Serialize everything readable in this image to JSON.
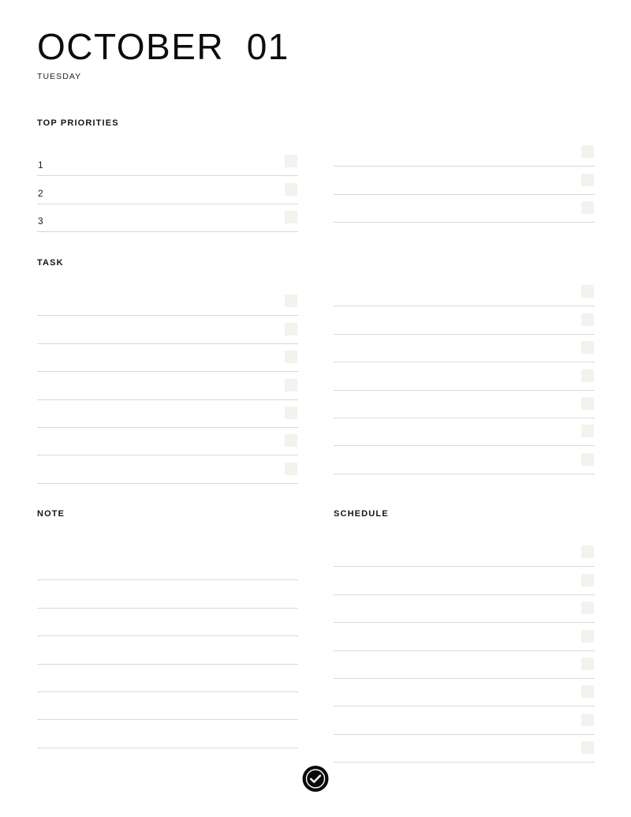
{
  "header": {
    "title": "OCTOBER  01",
    "weekday": "TUESDAY"
  },
  "sections": {
    "top_priorities": {
      "heading": "TOP PRIORITIES",
      "left_rows": [
        {
          "number": "1",
          "value": "",
          "checkbox": true
        },
        {
          "number": "2",
          "value": "",
          "checkbox": true
        },
        {
          "number": "3",
          "value": "",
          "checkbox": true
        }
      ],
      "right_rows": [
        {
          "number": "",
          "value": "",
          "checkbox": true
        },
        {
          "number": "",
          "value": "",
          "checkbox": true
        },
        {
          "number": "",
          "value": "",
          "checkbox": true
        }
      ]
    },
    "task": {
      "heading": "TASK",
      "left_rows": [
        {
          "value": "",
          "checkbox": true
        },
        {
          "value": "",
          "checkbox": true
        },
        {
          "value": "",
          "checkbox": true
        },
        {
          "value": "",
          "checkbox": true
        },
        {
          "value": "",
          "checkbox": true
        },
        {
          "value": "",
          "checkbox": true
        },
        {
          "value": "",
          "checkbox": true
        }
      ],
      "right_rows": [
        {
          "value": "",
          "checkbox": true
        },
        {
          "value": "",
          "checkbox": true
        },
        {
          "value": "",
          "checkbox": true
        },
        {
          "value": "",
          "checkbox": true
        },
        {
          "value": "",
          "checkbox": true
        },
        {
          "value": "",
          "checkbox": true
        },
        {
          "value": "",
          "checkbox": true
        }
      ]
    },
    "note": {
      "heading": "NOTE",
      "rows": [
        {
          "value": "",
          "checkbox": false
        },
        {
          "value": "",
          "checkbox": false
        },
        {
          "value": "",
          "checkbox": false
        },
        {
          "value": "",
          "checkbox": false
        },
        {
          "value": "",
          "checkbox": false
        },
        {
          "value": "",
          "checkbox": false
        },
        {
          "value": "",
          "checkbox": false
        }
      ]
    },
    "schedule": {
      "heading": "SCHEDULE",
      "rows": [
        {
          "value": "",
          "checkbox": true
        },
        {
          "value": "",
          "checkbox": true
        },
        {
          "value": "",
          "checkbox": true
        },
        {
          "value": "",
          "checkbox": true
        },
        {
          "value": "",
          "checkbox": true
        },
        {
          "value": "",
          "checkbox": true
        },
        {
          "value": "",
          "checkbox": true
        },
        {
          "value": "",
          "checkbox": true
        }
      ]
    }
  },
  "footer": {
    "badge_icon": "check-circle-icon"
  },
  "colors": {
    "page_background": "#ffffff",
    "text": "#1a1a1a",
    "rule_line": "#d8d8d8",
    "checkbox_fill": "#f3f2ed",
    "badge": "#0a0a0a"
  }
}
